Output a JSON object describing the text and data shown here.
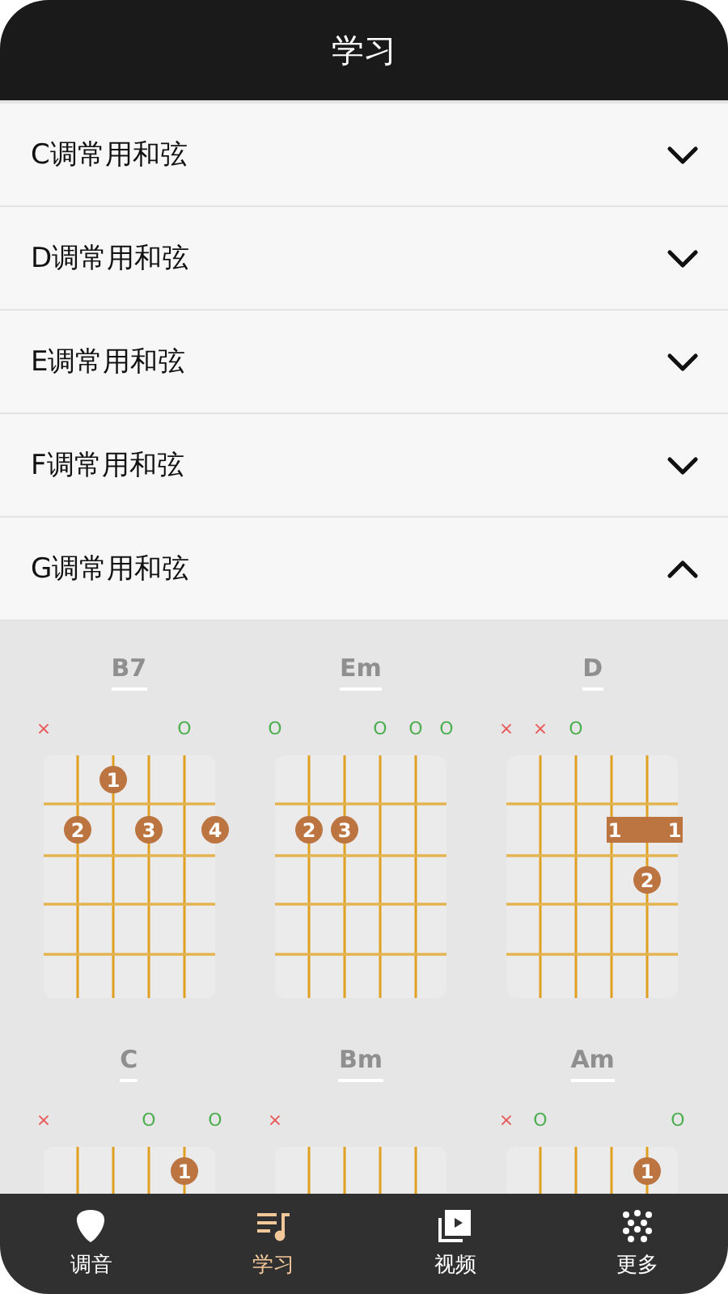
{
  "header": {
    "title": "学习"
  },
  "sections": [
    {
      "title": "C调常用和弦",
      "expanded": false
    },
    {
      "title": "D调常用和弦",
      "expanded": false
    },
    {
      "title": "E调常用和弦",
      "expanded": false
    },
    {
      "title": "F调常用和弦",
      "expanded": false
    },
    {
      "title": "G调常用和弦",
      "expanded": true,
      "chords": [
        {
          "name": "B7",
          "strings": [
            {
              "kind": "muted",
              "text": "×"
            },
            {
              "kind": "none"
            },
            {
              "kind": "none"
            },
            {
              "kind": "none"
            },
            {
              "kind": "open",
              "text": "O"
            },
            {
              "kind": "none"
            }
          ],
          "frets": [
            [
              {
                "kind": "none"
              },
              {
                "kind": "none"
              },
              {
                "kind": "dot",
                "text": "1"
              },
              {
                "kind": "none"
              },
              {
                "kind": "none"
              },
              {
                "kind": "none"
              }
            ],
            [
              {
                "kind": "none"
              },
              {
                "kind": "dot",
                "text": "2"
              },
              {
                "kind": "none"
              },
              {
                "kind": "dot",
                "text": "3"
              },
              {
                "kind": "none"
              },
              {
                "kind": "dot",
                "text": "4"
              }
            ]
          ]
        },
        {
          "name": "Em",
          "strings": [
            {
              "kind": "open",
              "text": "O"
            },
            {
              "kind": "none"
            },
            {
              "kind": "none"
            },
            {
              "kind": "open",
              "text": "O"
            },
            {
              "kind": "open",
              "text": "O"
            },
            {
              "kind": "open",
              "text": "O"
            }
          ],
          "frets": [
            [
              {
                "kind": "none"
              },
              {
                "kind": "none"
              },
              {
                "kind": "none"
              },
              {
                "kind": "none"
              },
              {
                "kind": "none"
              },
              {
                "kind": "none"
              }
            ],
            [
              {
                "kind": "none"
              },
              {
                "kind": "dot",
                "text": "2"
              },
              {
                "kind": "dot",
                "text": "3"
              },
              {
                "kind": "none"
              },
              {
                "kind": "none"
              },
              {
                "kind": "none"
              }
            ]
          ]
        },
        {
          "name": "D",
          "strings": [
            {
              "kind": "muted",
              "text": "×"
            },
            {
              "kind": "muted",
              "text": "×"
            },
            {
              "kind": "open",
              "text": "O"
            },
            {
              "kind": "none"
            },
            {
              "kind": "none"
            },
            {
              "kind": "none"
            }
          ],
          "frets": [
            [
              {
                "kind": "none"
              },
              {
                "kind": "none"
              },
              {
                "kind": "none"
              },
              {
                "kind": "none"
              },
              {
                "kind": "none"
              },
              {
                "kind": "none"
              }
            ],
            [
              {
                "kind": "none"
              },
              {
                "kind": "none"
              },
              {
                "kind": "none"
              },
              {
                "kind": "barre-start",
                "text": "1"
              },
              {
                "kind": "barre-mid"
              },
              {
                "kind": "barre-end",
                "text": "1"
              }
            ],
            [
              {
                "kind": "none"
              },
              {
                "kind": "none"
              },
              {
                "kind": "none"
              },
              {
                "kind": "none"
              },
              {
                "kind": "dot",
                "text": "2"
              },
              {
                "kind": "none"
              }
            ]
          ]
        },
        {
          "name": "C",
          "strings": [
            {
              "kind": "muted",
              "text": "×"
            },
            {
              "kind": "none"
            },
            {
              "kind": "none"
            },
            {
              "kind": "open",
              "text": "O"
            },
            {
              "kind": "none"
            },
            {
              "kind": "open",
              "text": "O"
            }
          ],
          "frets": [
            [
              {
                "kind": "none"
              },
              {
                "kind": "none"
              },
              {
                "kind": "none"
              },
              {
                "kind": "none"
              },
              {
                "kind": "dot",
                "text": "1"
              },
              {
                "kind": "none"
              }
            ]
          ]
        },
        {
          "name": "Bm",
          "strings": [
            {
              "kind": "muted",
              "text": "×"
            },
            {
              "kind": "none"
            },
            {
              "kind": "none"
            },
            {
              "kind": "none"
            },
            {
              "kind": "none"
            },
            {
              "kind": "none"
            }
          ]
        },
        {
          "name": "Am",
          "strings": [
            {
              "kind": "muted",
              "text": "×"
            },
            {
              "kind": "open",
              "text": "O"
            },
            {
              "kind": "none"
            },
            {
              "kind": "none"
            },
            {
              "kind": "none"
            },
            {
              "kind": "open",
              "text": "O"
            }
          ],
          "frets": [
            [
              {
                "kind": "none"
              },
              {
                "kind": "none"
              },
              {
                "kind": "none"
              },
              {
                "kind": "none"
              },
              {
                "kind": "dot",
                "text": "1"
              },
              {
                "kind": "none"
              }
            ]
          ]
        }
      ]
    }
  ],
  "nav": [
    {
      "label": "调音",
      "selected": false
    },
    {
      "label": "学习",
      "selected": true
    },
    {
      "label": "视频",
      "selected": false
    },
    {
      "label": "更多",
      "selected": false
    }
  ]
}
